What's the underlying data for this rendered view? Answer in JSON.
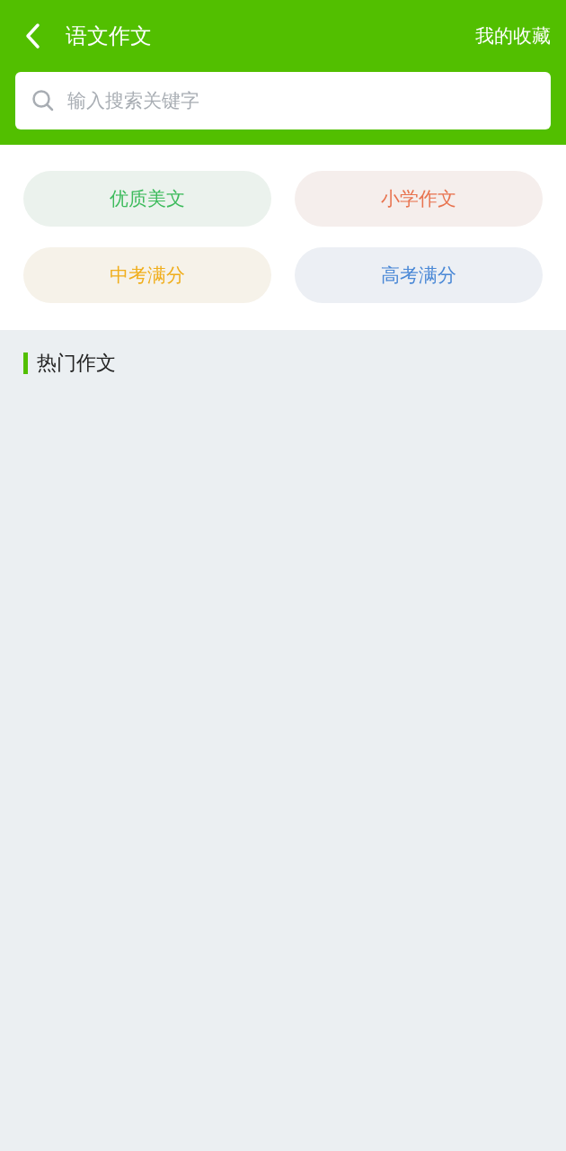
{
  "header": {
    "title": "语文作文",
    "action": "我的收藏"
  },
  "search": {
    "placeholder": "输入搜索关键字"
  },
  "categories": [
    {
      "label": "优质美文",
      "color": "#3dbb5c"
    },
    {
      "label": "小学作文",
      "color": "#e8734f"
    },
    {
      "label": "中考满分",
      "color": "#f0ae1c"
    },
    {
      "label": "高考满分",
      "color": "#4a88d6"
    }
  ],
  "section": {
    "title": "热门作文"
  }
}
